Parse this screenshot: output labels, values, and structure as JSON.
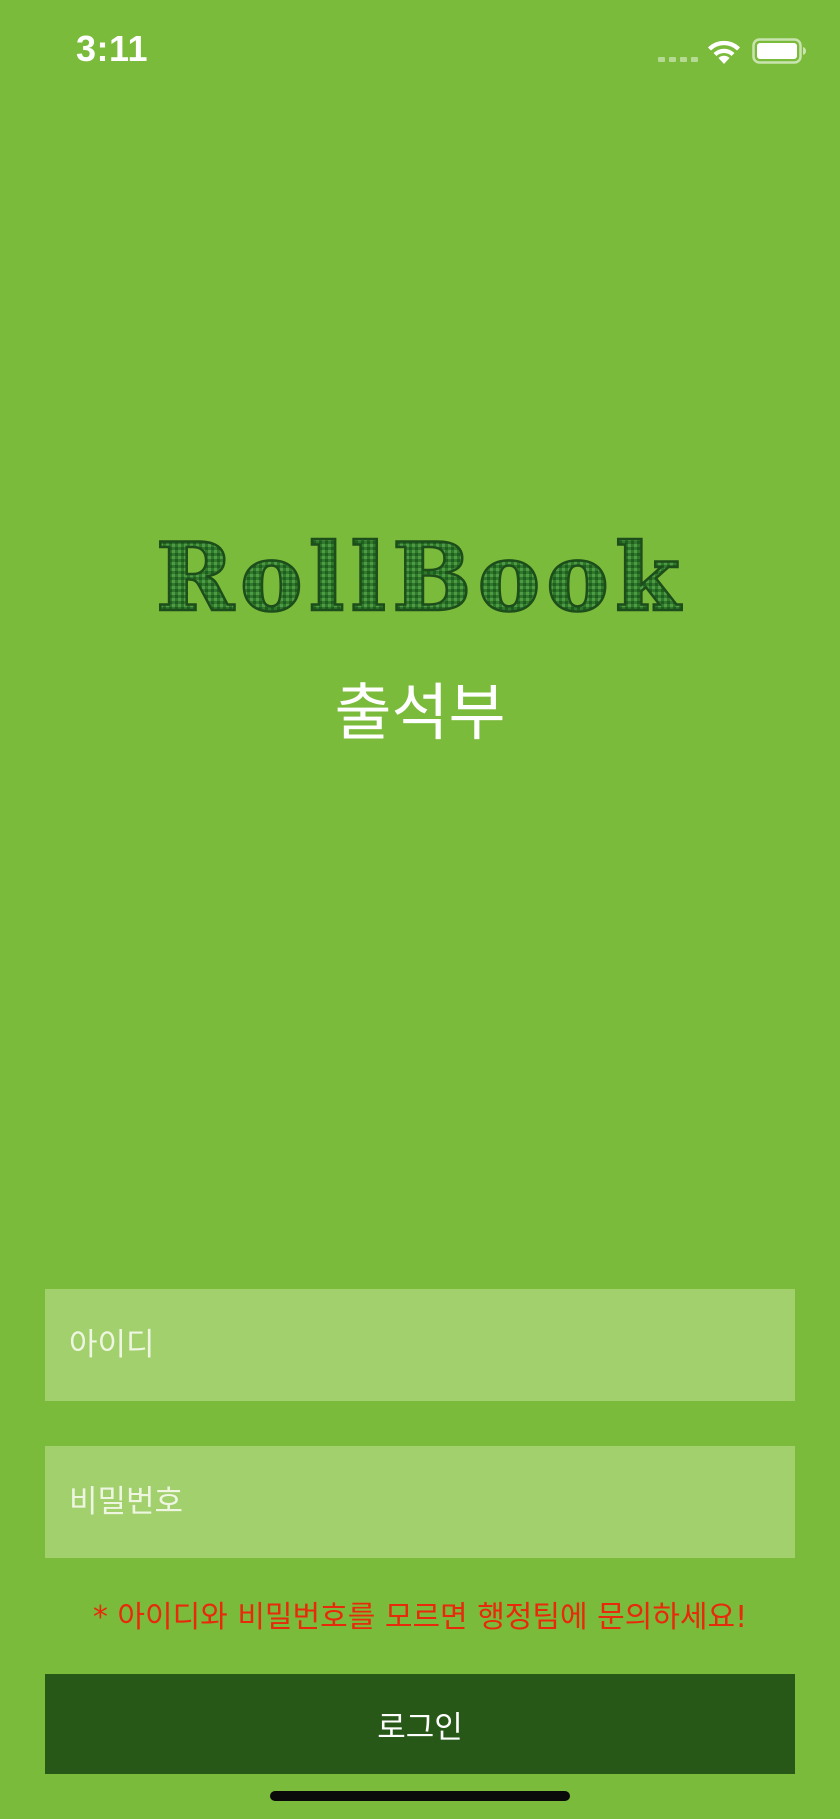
{
  "status_bar": {
    "time": "3:11",
    "icons": [
      "signal-dots-icon",
      "wifi-icon",
      "battery-icon"
    ]
  },
  "logo": {
    "text": "RollBook"
  },
  "subtitle": "출석부",
  "form": {
    "id_placeholder": "아이디",
    "id_value": "",
    "password_placeholder": "비밀번호",
    "password_value": "",
    "notice": "* 아이디와 비밀번호를 모르면 행정팀에 문의하세요!",
    "login_label": "로그인"
  },
  "colors": {
    "background": "#7bbb3b",
    "field_background": "#a2d06d",
    "button_background": "#275817",
    "notice": "#e8290c",
    "logo": "#2e7a2a"
  }
}
